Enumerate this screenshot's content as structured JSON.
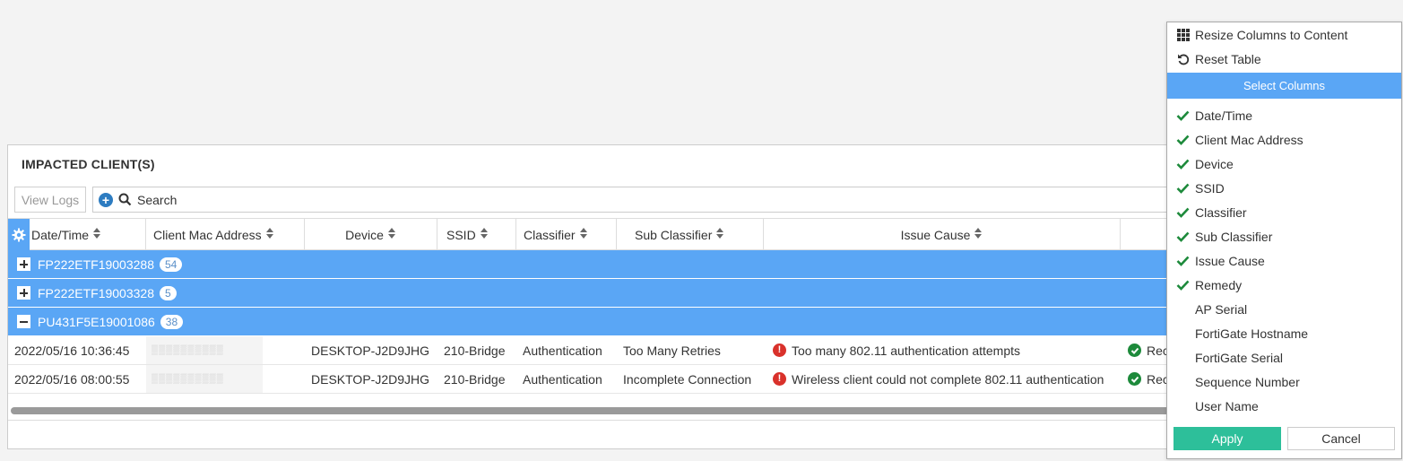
{
  "panel": {
    "title": "IMPACTED CLIENT(S)",
    "view_logs_label": "View Logs",
    "search_placeholder": "Search"
  },
  "table": {
    "columns": [
      "Date/Time",
      "Client Mac Address",
      "Device",
      "SSID",
      "Classifier",
      "Sub Classifier",
      "Issue Cause"
    ],
    "groups": [
      {
        "label": "FP222ETF19003288",
        "count": "54",
        "expanded": false
      },
      {
        "label": "FP222ETF19003328",
        "count": "5",
        "expanded": false
      },
      {
        "label": "PU431F5E19001086",
        "count": "38",
        "expanded": true
      }
    ],
    "rows": [
      {
        "datetime": "2022/05/16 10:36:45",
        "device": "DESKTOP-J2D9JHG",
        "ssid": "210-Bridge",
        "classifier": "Authentication",
        "sub_classifier": "Too Many Retries",
        "issue_cause": "Too many 802.11 authentication attempts",
        "remedy": "Rec"
      },
      {
        "datetime": "2022/05/16 08:00:55",
        "device": "DESKTOP-J2D9JHG",
        "ssid": "210-Bridge",
        "classifier": "Authentication",
        "sub_classifier": "Incomplete Connection",
        "issue_cause": "Wireless client could not complete 802.11 authentication",
        "remedy": "Rec"
      }
    ]
  },
  "menu": {
    "resize_label": "Resize Columns to Content",
    "reset_label": "Reset Table",
    "section_label": "Select Columns",
    "columns": [
      {
        "label": "Date/Time",
        "checked": true
      },
      {
        "label": "Client Mac Address",
        "checked": true
      },
      {
        "label": "Device",
        "checked": true
      },
      {
        "label": "SSID",
        "checked": true
      },
      {
        "label": "Classifier",
        "checked": true
      },
      {
        "label": "Sub Classifier",
        "checked": true
      },
      {
        "label": "Issue Cause",
        "checked": true
      },
      {
        "label": "Remedy",
        "checked": true
      },
      {
        "label": "AP Serial",
        "checked": false
      },
      {
        "label": "FortiGate Hostname",
        "checked": false
      },
      {
        "label": "FortiGate Serial",
        "checked": false
      },
      {
        "label": "Sequence Number",
        "checked": false
      },
      {
        "label": "User Name",
        "checked": false
      }
    ],
    "apply_label": "Apply",
    "cancel_label": "Cancel"
  },
  "colors": {
    "accent_blue": "#5aa6f5",
    "apply_green": "#2dbf9a",
    "check_green": "#1d8a3b",
    "error_red": "#d9312b"
  }
}
